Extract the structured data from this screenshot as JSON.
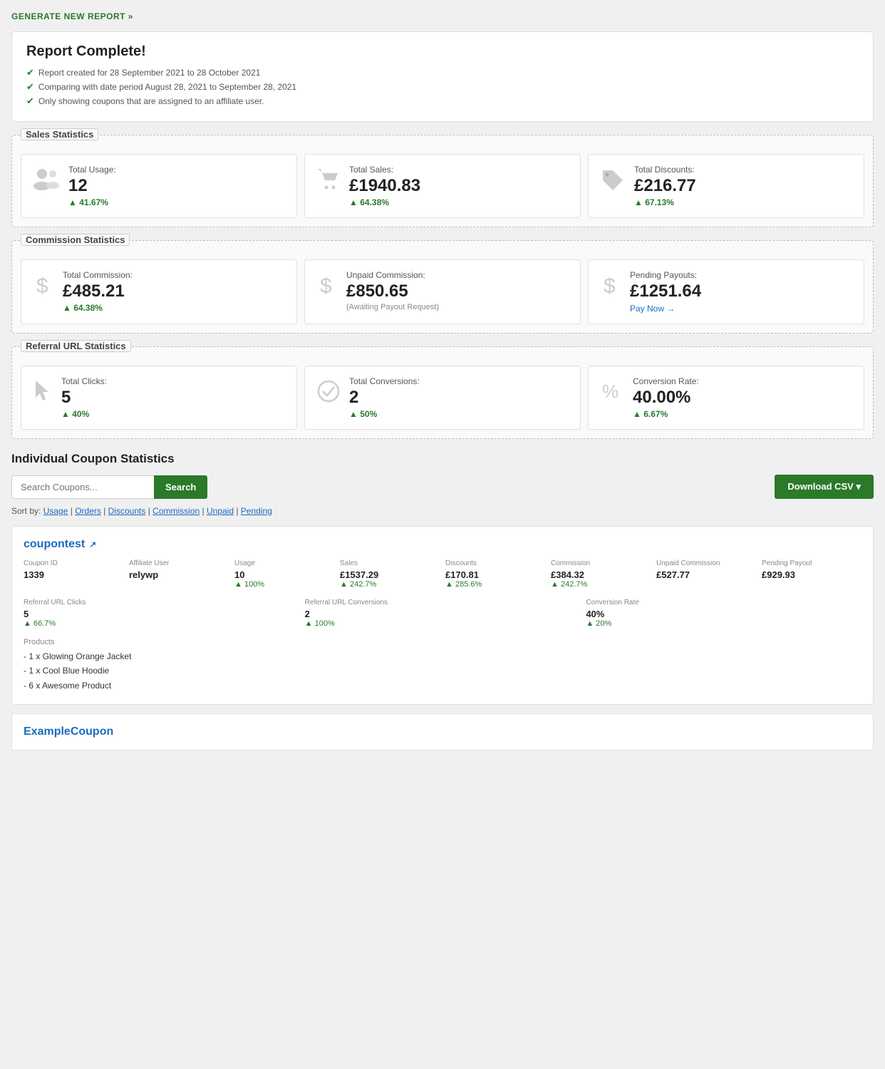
{
  "generate_link": "GENERATE NEW REPORT »",
  "report": {
    "title": "Report Complete!",
    "items": [
      "Report created for 28 September 2021 to 28 October 2021",
      "Comparing with date period August 28, 2021 to September 28, 2021",
      "Only showing coupons that are assigned to an affiliate user."
    ]
  },
  "sales_statistics": {
    "title": "Sales Statistics",
    "cards": [
      {
        "icon": "people",
        "label": "Total Usage:",
        "value": "12",
        "change": "41.67%"
      },
      {
        "icon": "cart",
        "label": "Total Sales:",
        "value": "£1940.83",
        "change": "64.38%"
      },
      {
        "icon": "tag",
        "label": "Total Discounts:",
        "value": "£216.77",
        "change": "67.13%"
      }
    ]
  },
  "commission_statistics": {
    "title": "Commission Statistics",
    "cards": [
      {
        "icon": "dollar",
        "label": "Total Commission:",
        "value": "£485.21",
        "change": "64.38%",
        "change_type": "percent"
      },
      {
        "icon": "dollar",
        "label": "Unpaid Commission:",
        "value": "£850.65",
        "sub_text": "(Awaiting Payout Request)"
      },
      {
        "icon": "dollar",
        "label": "Pending Payouts:",
        "value": "£1251.64",
        "action_text": "Pay Now →"
      }
    ]
  },
  "referral_statistics": {
    "title": "Referral URL Statistics",
    "cards": [
      {
        "icon": "cursor",
        "label": "Total Clicks:",
        "value": "5",
        "change": "40%"
      },
      {
        "icon": "checkmark",
        "label": "Total Conversions:",
        "value": "2",
        "change": "50%"
      },
      {
        "icon": "percent",
        "label": "Conversion Rate:",
        "value": "40.00%",
        "change": "6.67%"
      }
    ]
  },
  "individual": {
    "title": "Individual Coupon Statistics",
    "search_placeholder": "Search Coupons...",
    "search_button": "Search",
    "download_button": "Download CSV ▾",
    "sort_label": "Sort by:",
    "sort_options": [
      "Usage",
      "Orders",
      "Discounts",
      "Commission",
      "Unpaid",
      "Pending"
    ]
  },
  "coupons": [
    {
      "name": "coupontest",
      "ext_link": "↗",
      "fields": [
        {
          "label": "Coupon ID",
          "value": "1339",
          "change": ""
        },
        {
          "label": "Affiliate User",
          "value": "relywp",
          "change": ""
        },
        {
          "label": "Usage",
          "value": "10",
          "change": "100%"
        },
        {
          "label": "Sales",
          "value": "£1537.29",
          "change": "242.7%"
        },
        {
          "label": "Discounts",
          "value": "£170.81",
          "change": "285.6%"
        },
        {
          "label": "Commission",
          "value": "£384.32",
          "change": "242.7%"
        },
        {
          "label": "Unpaid Commission",
          "value": "£527.77",
          "change": ""
        },
        {
          "label": "Pending Payout",
          "value": "£929.93",
          "change": ""
        }
      ],
      "url_fields": [
        {
          "label": "Referral URL Clicks",
          "value": "5",
          "change": "66.7%"
        },
        {
          "label": "Referral URL Conversions",
          "value": "2",
          "change": "100%"
        },
        {
          "label": "Conversion Rate",
          "value": "40%",
          "change": "20%"
        }
      ],
      "products_label": "Products",
      "products": [
        "- 1 x Glowing Orange Jacket",
        "- 1 x Cool Blue Hoodie",
        "- 6 x Awesome Product"
      ]
    }
  ],
  "partial_coupon": {
    "name": "ExampleCoupon"
  }
}
